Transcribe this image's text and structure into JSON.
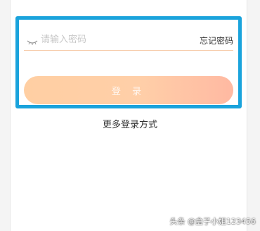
{
  "password_field": {
    "placeholder": "请输入密码",
    "visibility_icon": "eye-closed-icon"
  },
  "forgot_password_label": "忘记密码",
  "login_button_label": "登 录",
  "more_login_methods_label": "更多登录方式",
  "watermark_text": "头条 @盒子小姐123456",
  "colors": {
    "highlight_frame": "#1aa3dc",
    "button_gradient_start": "#ffcfa3",
    "button_gradient_end": "#ffb9a2",
    "input_underline": "#f6c9a6"
  }
}
